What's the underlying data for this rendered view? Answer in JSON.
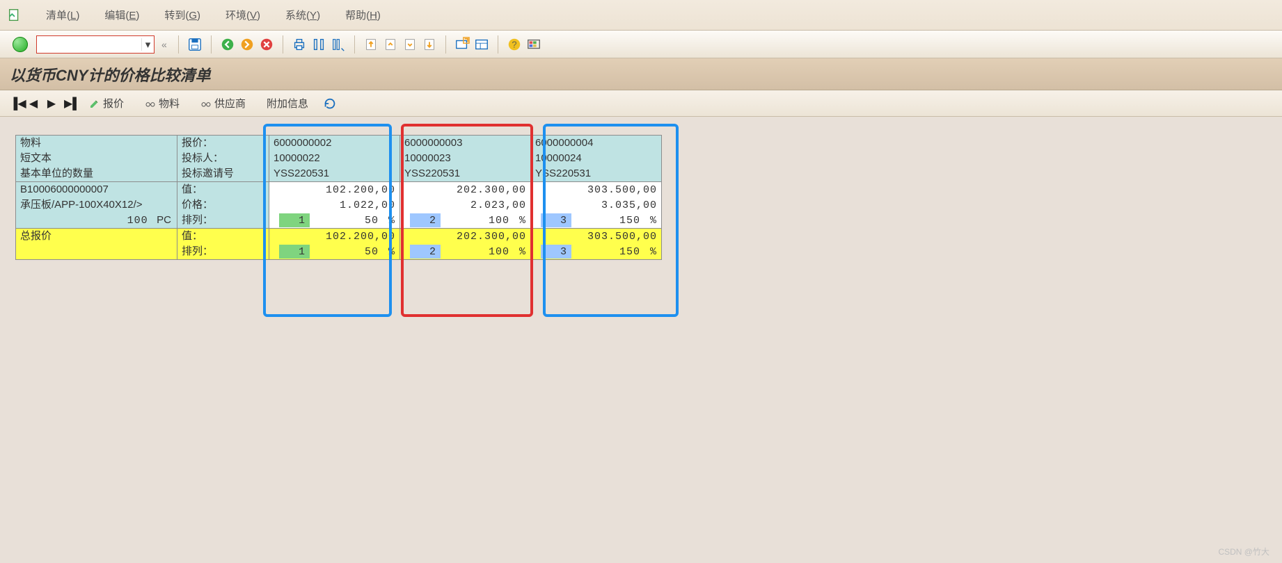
{
  "menu": {
    "items": [
      {
        "pre": "清单(",
        "u": "L",
        "post": ")"
      },
      {
        "pre": "编辑(",
        "u": "E",
        "post": ")"
      },
      {
        "pre": "转到(",
        "u": "G",
        "post": ")"
      },
      {
        "pre": "环境(",
        "u": "V",
        "post": ")"
      },
      {
        "pre": "系统(",
        "u": "Y",
        "post": ")"
      },
      {
        "pre": "帮助(",
        "u": "H",
        "post": ")"
      }
    ]
  },
  "title": "以货币CNY计的价格比较清单",
  "app_toolbar": {
    "quote": "报价",
    "material": "物料",
    "vendor": "供应商",
    "extra": "附加信息"
  },
  "grid": {
    "labels": {
      "material": "物料",
      "shorttext": "短文本",
      "base_qty": "基本单位的数量",
      "quote": "报价：",
      "bidder": "投标人：",
      "rfq": "投标邀请号",
      "value": "值：",
      "price": "价格：",
      "rank": "排列：",
      "total": "总报价"
    },
    "material_row": {
      "code": "B10006000000007",
      "desc": "承压板/APP-100X40X12/>",
      "qty": "100",
      "unit": "PC"
    },
    "quotes": [
      {
        "q": "6000000002",
        "bidder": "10000022",
        "rfq": "YSS220531",
        "value": "102.200,00",
        "price": "1.022,00",
        "rank": "1",
        "pct": "50",
        "rank_color": "green"
      },
      {
        "q": "6000000003",
        "bidder": "10000023",
        "rfq": "YSS220531",
        "value": "202.300,00",
        "price": "2.023,00",
        "rank": "2",
        "pct": "100",
        "rank_color": "blue"
      },
      {
        "q": "6000000004",
        "bidder": "10000024",
        "rfq": "YSS220531",
        "value": "303.500,00",
        "price": "3.035,00",
        "rank": "3",
        "pct": "150",
        "rank_color": "blue"
      }
    ]
  },
  "watermark": "CSDN @竹大"
}
